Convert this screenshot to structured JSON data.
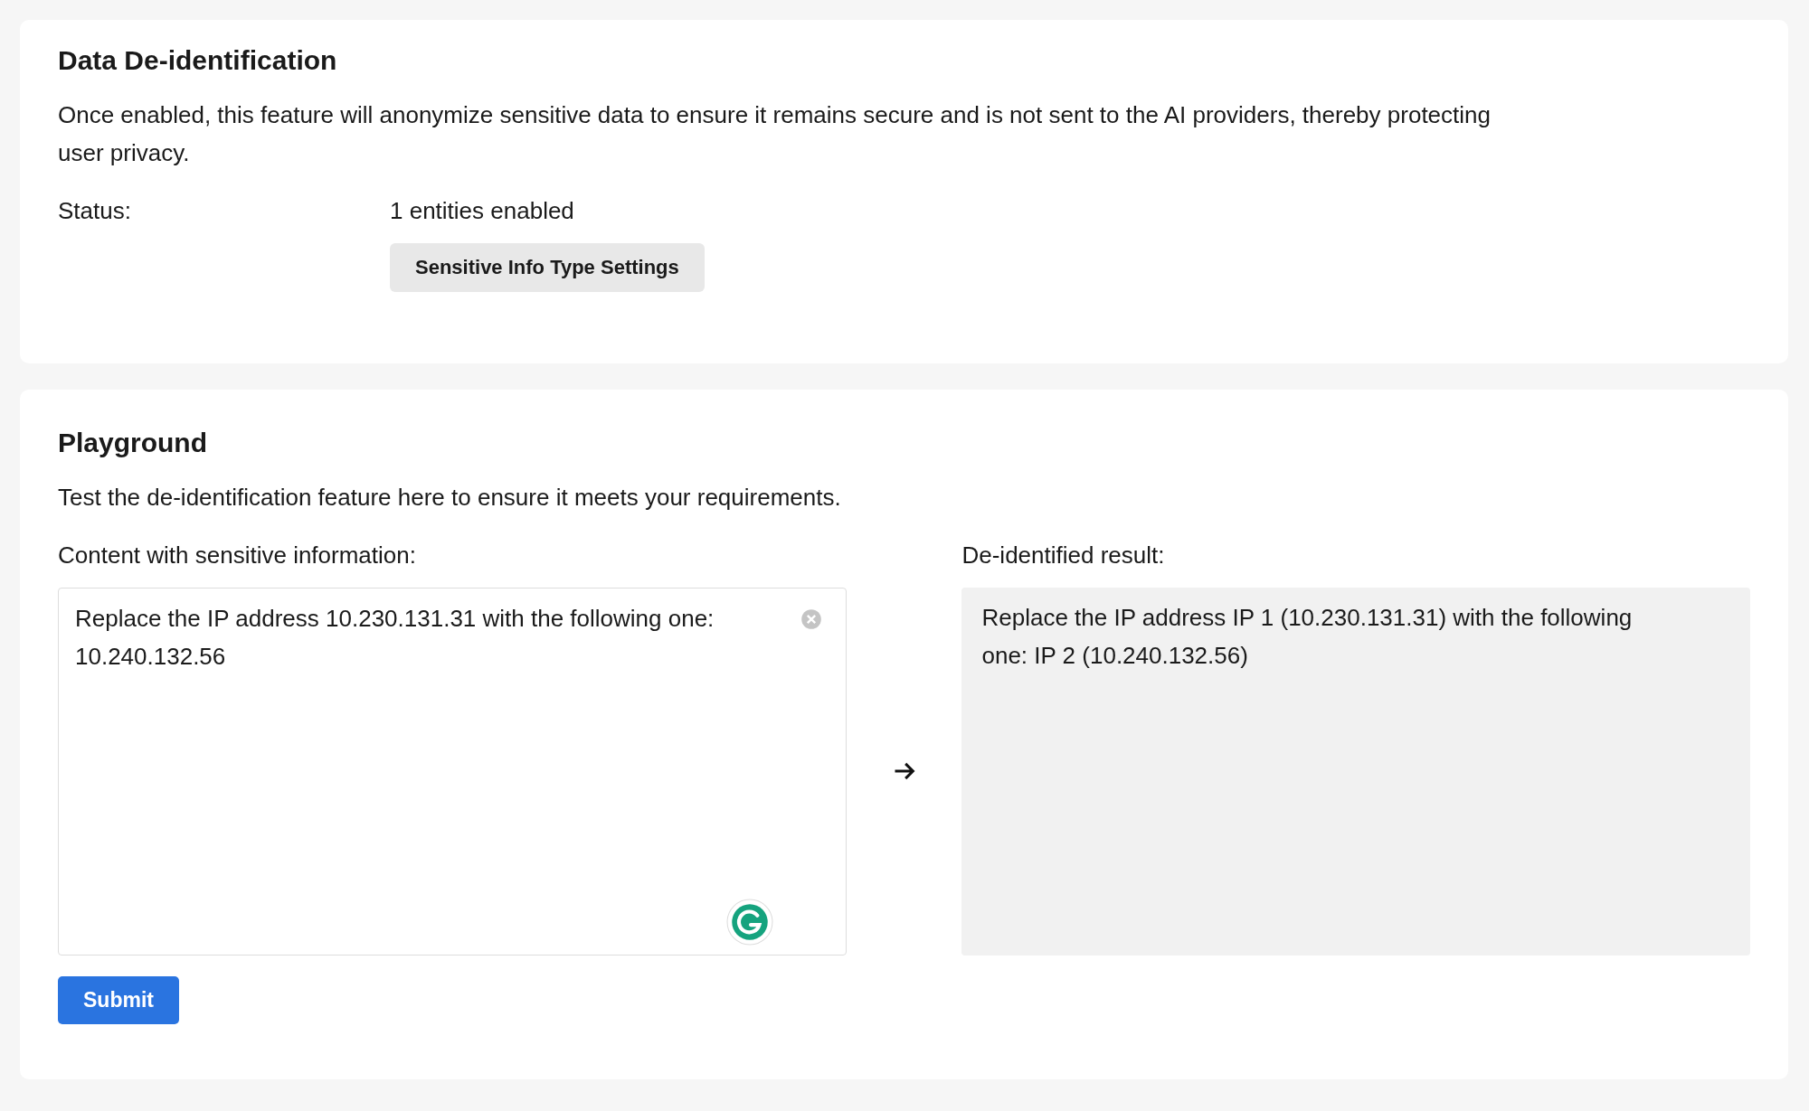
{
  "deidentification": {
    "title": "Data De-identification",
    "description": "Once enabled, this feature will anonymize sensitive data to ensure it remains secure and is not sent to the AI providers, thereby protecting user privacy.",
    "status_label": "Status:",
    "status_value": "1 entities enabled",
    "settings_button": "Sensitive Info Type Settings"
  },
  "playground": {
    "title": "Playground",
    "description": "Test the de-identification feature here to ensure it meets your requirements.",
    "input_label": "Content with sensitive information:",
    "input_value": "Replace the IP address 10.230.131.31 with the following one: 10.240.132.56",
    "result_label": "De-identified result:",
    "result_value": "Replace the IP address IP 1 (10.230.131.31) with the following one: IP 2 (10.240.132.56)",
    "submit_button": "Submit"
  }
}
